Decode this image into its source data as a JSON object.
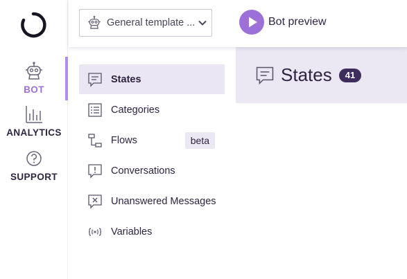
{
  "app": {
    "accent_color": "#9d6fd8",
    "dark_color": "#2d2440"
  },
  "rail": {
    "items": [
      {
        "label": "BOT",
        "icon": "robot-icon",
        "active": true
      },
      {
        "label": "ANALYTICS",
        "icon": "bar-chart-icon",
        "active": false
      },
      {
        "label": "SUPPORT",
        "icon": "help-icon",
        "active": false
      }
    ]
  },
  "topbar": {
    "template_select": {
      "value": "General template ...",
      "icon": "robot-icon"
    },
    "preview_label": "Bot preview"
  },
  "nav": {
    "items": [
      {
        "label": "States",
        "icon": "chat-lines-icon",
        "active": true
      },
      {
        "label": "Categories",
        "icon": "list-icon"
      },
      {
        "label": "Flows",
        "icon": "flow-icon",
        "badge": "beta"
      },
      {
        "label": "Conversations",
        "icon": "chat-alert-icon"
      },
      {
        "label": "Unanswered Messages",
        "icon": "chat-x-icon"
      },
      {
        "label": "Variables",
        "icon": "variable-icon"
      }
    ]
  },
  "main": {
    "title": "States",
    "count": "41"
  }
}
